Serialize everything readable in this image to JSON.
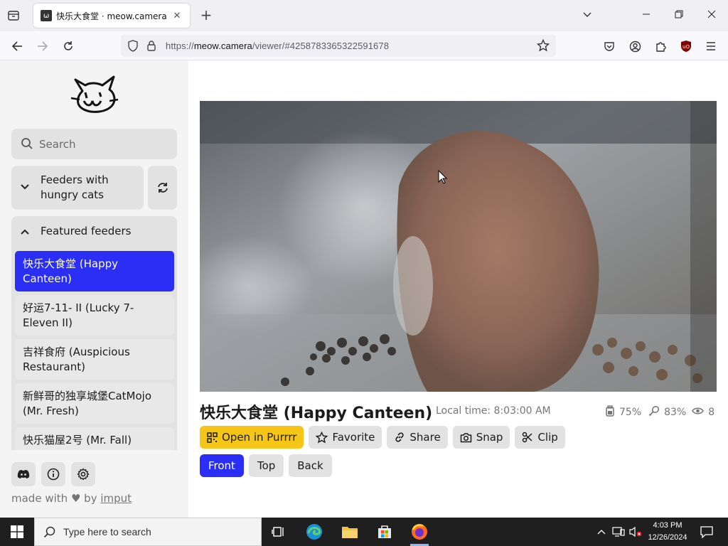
{
  "browser": {
    "tab_title": "快乐大食堂 · meow.camera",
    "url_prefix": "https://",
    "url_domain": "meow.camera",
    "url_path": "/viewer/#4258783365322591678"
  },
  "sidebar": {
    "search_placeholder": "Search",
    "filter_label_line1": "Feeders with",
    "filter_label_line2": "hungry cats",
    "featured_label": "Featured feeders",
    "feeders": [
      {
        "line1": "快乐大食堂 (Happy",
        "line2": "Canteen)",
        "active": true
      },
      {
        "line1": "好运7-11- II  (Lucky 7-",
        "line2": "Eleven II)",
        "active": false
      },
      {
        "line1": "吉祥食府 (Auspicious",
        "line2": "Restaurant)",
        "active": false
      },
      {
        "line1": "新鲜哥的独享城堡CatMojo",
        "line2": "(Mr. Fresh)",
        "active": false
      },
      {
        "line1": "快乐猫屋2号 (Mr. Fall)",
        "line2": "",
        "active": false
      }
    ],
    "made_with_prefix": "made with",
    "made_with_by": "by",
    "made_with_author": "imput"
  },
  "main": {
    "camera_title": "快乐大食堂 (Happy Canteen)",
    "local_time": "Local time: 8:03:00 AM",
    "food_level": "75%",
    "battery_level": "83%",
    "viewers": "8",
    "actions": {
      "open": "Open in Purrrr",
      "favorite": "Favorite",
      "share": "Share",
      "snap": "Snap",
      "clip": "Clip"
    },
    "views": [
      "Front",
      "Top",
      "Back"
    ],
    "active_view": "Front"
  },
  "taskbar": {
    "search_placeholder": "Type here to search",
    "time": "4:03 PM",
    "date": "12/26/2024"
  },
  "colors": {
    "accent": "#2b2ef5",
    "open_button": "#f5c518"
  }
}
